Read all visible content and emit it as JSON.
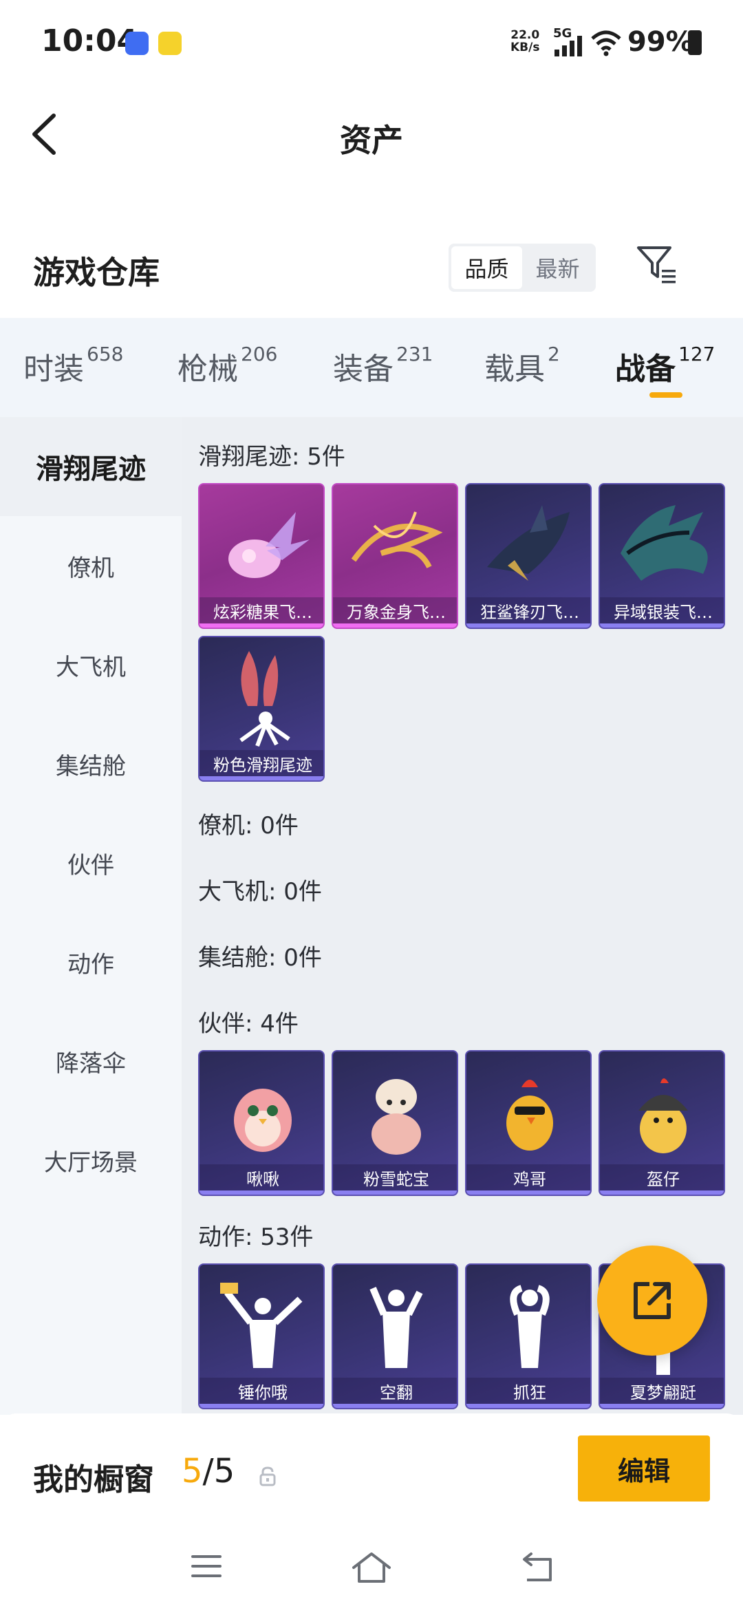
{
  "status_bar": {
    "time": "10:04",
    "net_speed_value": "22.0",
    "net_speed_unit": "KB/s",
    "network": "5G",
    "battery": "99%"
  },
  "header": {
    "title": "资产"
  },
  "warehouse": {
    "title": "游戏仓库",
    "sort_options": [
      "品质",
      "最新"
    ],
    "sort_selected": "品质"
  },
  "category_tabs": [
    {
      "label": "时装",
      "count": "658"
    },
    {
      "label": "枪械",
      "count": "206"
    },
    {
      "label": "装备",
      "count": "231"
    },
    {
      "label": "载具",
      "count": "2"
    },
    {
      "label": "战备",
      "count": "127",
      "active": true
    }
  ],
  "side_nav": [
    "滑翔尾迹",
    "僚机",
    "大飞机",
    "集结舱",
    "伙伴",
    "动作",
    "降落伞",
    "大厅场景"
  ],
  "groups": {
    "trail": {
      "title": "滑翔尾迹: 5件",
      "items": [
        "炫彩糖果飞…",
        "万象金身飞…",
        "狂鲨锋刃飞…",
        "异域银装飞…",
        "粉色滑翔尾迹"
      ]
    },
    "wingman": {
      "title": "僚机: 0件"
    },
    "plane": {
      "title": "大飞机: 0件"
    },
    "pod": {
      "title": "集结舱: 0件"
    },
    "partner": {
      "title": "伙伴: 4件",
      "items": [
        "啾啾",
        "粉雪蛇宝",
        "鸡哥",
        "盔仔"
      ]
    },
    "action": {
      "title": "动作: 53件",
      "items": [
        "锤你哦",
        "空翻",
        "抓狂",
        "夏梦翩跹"
      ]
    }
  },
  "bottom_bar": {
    "showcase_label": "我的橱窗",
    "showcase_current": "5",
    "showcase_total": "/5",
    "edit_label": "编辑"
  },
  "colors": {
    "accent": "#f7b10a",
    "epic_card": "#a63a9d",
    "rare_card": "#3a3576"
  },
  "icons": [
    "back-arrow-icon",
    "filter-icon",
    "lock-icon",
    "share-icon",
    "menu-icon",
    "home-icon",
    "return-icon"
  ]
}
